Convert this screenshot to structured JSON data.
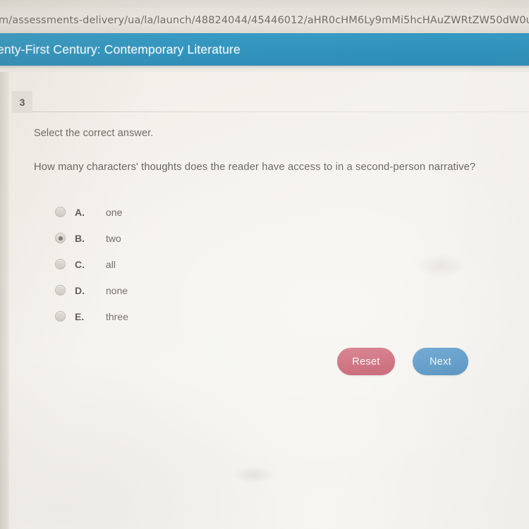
{
  "browser": {
    "url": "m/assessments-delivery/ua/la/launch/48824044/45446012/aHR0cHM6Ly9mMi5hcHAuZWRtZW50dW0uY"
  },
  "course_header": {
    "title": "enty-First Century: Contemporary Literature"
  },
  "question": {
    "number": "3",
    "prompt": "Select the correct answer.",
    "text": "How many characters' thoughts does the reader have access to in a second-person narrative?",
    "options": [
      {
        "letter": "A.",
        "text": "one",
        "selected": false
      },
      {
        "letter": "B.",
        "text": "two",
        "selected": true
      },
      {
        "letter": "C.",
        "text": "all",
        "selected": false
      },
      {
        "letter": "D.",
        "text": "none",
        "selected": false
      },
      {
        "letter": "E.",
        "text": "three",
        "selected": false
      }
    ]
  },
  "actions": {
    "reset_label": "Reset",
    "next_label": "Next"
  },
  "colors": {
    "header_blue": "#2e93bd",
    "reset_red": "#c55365",
    "next_blue": "#4a90c3",
    "page_bg": "#f6f4ef",
    "badge_bg": "#e7e3dc"
  }
}
